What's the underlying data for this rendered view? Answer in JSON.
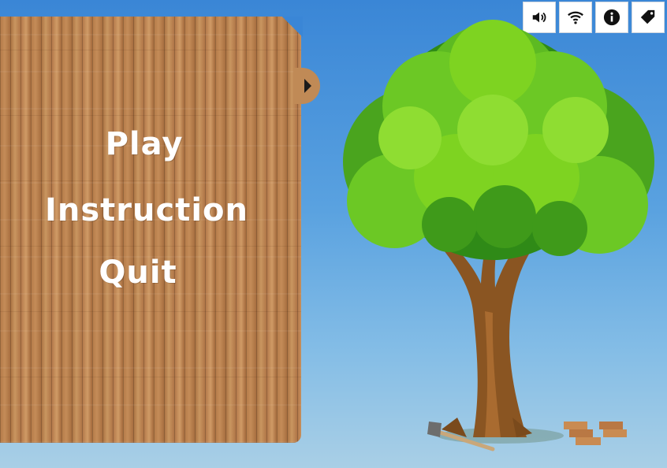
{
  "menu": {
    "play": "Play",
    "instruction": "Instruction",
    "quit": "Quit"
  },
  "toolbar": {
    "buttons": [
      "sound-icon",
      "wifi-icon",
      "info-icon",
      "tag-icon"
    ]
  },
  "colors": {
    "sky_top": "#3a86d6",
    "sky_bottom": "#a9cfe6",
    "wood": "#b57a48",
    "leaves_light": "#7ed321",
    "leaves_dark": "#2f8a17",
    "trunk": "#8a5522"
  }
}
